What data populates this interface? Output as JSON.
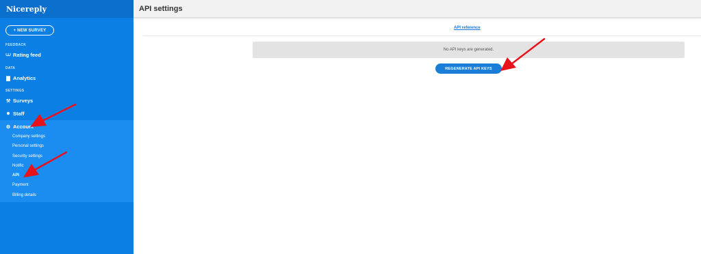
{
  "sidebar": {
    "brand": "Nicereply",
    "new_survey_label": "+ NEW SURVEY",
    "sections": {
      "feedback": "FEEDBACK",
      "data": "DATA",
      "settings": "SETTINGS"
    },
    "items": {
      "rating_feed": "Rating feed",
      "analytics": "Analytics",
      "surveys": "Surveys",
      "staff": "Staff",
      "account": "Account"
    },
    "account_sub": [
      "Company settings",
      "Personal settings",
      "Security settings",
      "Notific",
      "API",
      "Payment",
      "Billing details"
    ],
    "icons": {
      "rating_feed": "rss-icon",
      "analytics": "chart-icon",
      "surveys": "wrench-icon",
      "staff": "users-icon",
      "account": "gears-icon"
    }
  },
  "header": {
    "title": "API settings"
  },
  "main": {
    "api_reference_link": "API reference",
    "notice": "No API keys are generated.",
    "regenerate_button": "REGENERATE API KEYS"
  },
  "colors": {
    "sidebar": "#0b7fe3",
    "sidebar_active": "#1b8cf0",
    "button": "#1a7ed8",
    "annotation_arrow": "#e8121b"
  }
}
